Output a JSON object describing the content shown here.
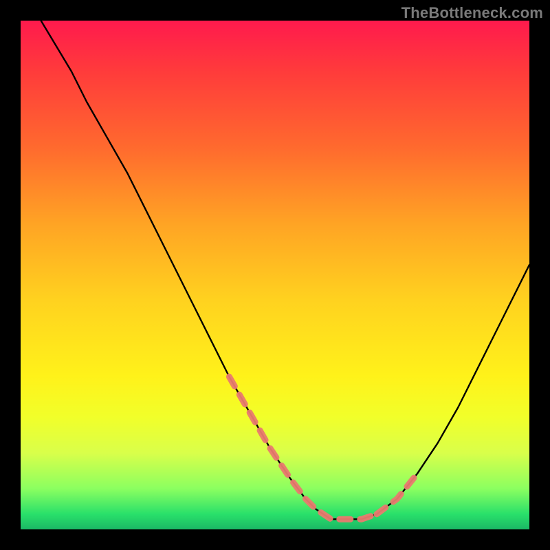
{
  "watermark": "TheBottleneck.com",
  "colors": {
    "background": "#000000",
    "curve": "#000000",
    "highlight": "#e97a6f"
  },
  "chart_data": {
    "type": "line",
    "title": "",
    "xlabel": "",
    "ylabel": "",
    "xlim": [
      0,
      100
    ],
    "ylim": [
      0,
      100
    ],
    "grid": false,
    "legend": false,
    "series": [
      {
        "name": "bottleneck-curve",
        "x": [
          4,
          7,
          10,
          13,
          17,
          21,
          25,
          29,
          33,
          37,
          41,
          45,
          49,
          53,
          56,
          58,
          61,
          64,
          67,
          70,
          74,
          78,
          82,
          86,
          90,
          94,
          98,
          100
        ],
        "y": [
          100,
          95,
          90,
          84,
          77,
          70,
          62,
          54,
          46,
          38,
          30,
          23,
          16,
          10,
          6,
          4,
          2,
          2,
          2,
          3,
          6,
          11,
          17,
          24,
          32,
          40,
          48,
          52
        ]
      }
    ],
    "highlight_segments": [
      {
        "name": "left-dash-region",
        "x": [
          41,
          45,
          49,
          53,
          56
        ],
        "y": [
          30,
          23,
          16,
          10,
          6
        ]
      },
      {
        "name": "trough-dash-region",
        "x": [
          56,
          58,
          61,
          64,
          67,
          70
        ],
        "y": [
          6,
          4,
          2,
          2,
          2,
          3
        ]
      },
      {
        "name": "right-dash-region",
        "x": [
          70,
          74,
          78
        ],
        "y": [
          3,
          6,
          11
        ]
      }
    ]
  }
}
